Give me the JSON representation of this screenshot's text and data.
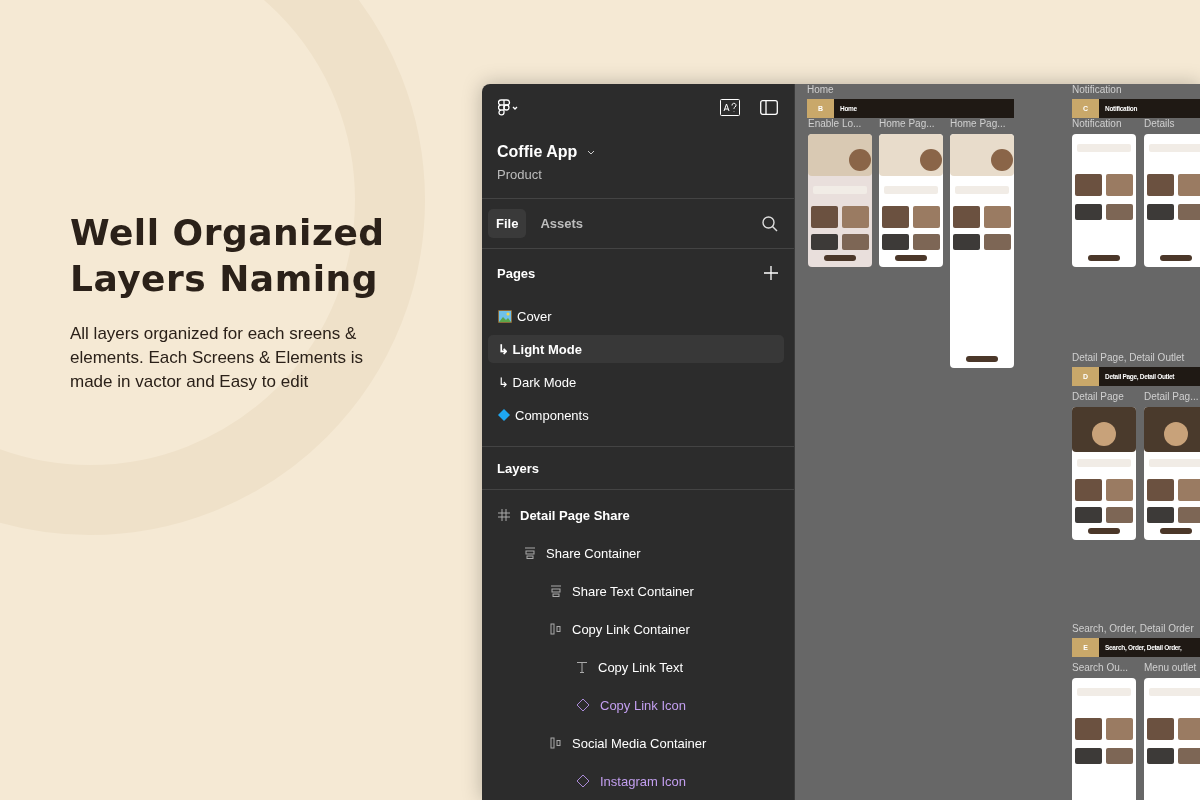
{
  "hero": {
    "title": "Well Organized Layers Naming",
    "text": "All layers organized for each sreens & elements. Each Screens & Elements is made in vactor and Easy to edit"
  },
  "sidebar": {
    "file_name": "Coffie App",
    "team": "Product",
    "tabs": [
      {
        "label": "File",
        "selected": true
      },
      {
        "label": "Assets",
        "selected": false
      }
    ],
    "pages_title": "Pages",
    "pages": [
      {
        "label": "Cover",
        "kind": "picture",
        "selected": false
      },
      {
        "label": "↳ Light Mode",
        "kind": "plain",
        "selected": true
      },
      {
        "label": "↳ Dark Mode",
        "kind": "plain",
        "selected": false
      },
      {
        "label": "Components",
        "kind": "component",
        "selected": false
      }
    ],
    "layers_title": "Layers",
    "layers": [
      {
        "name": "Detail Page Share",
        "kind": "frame",
        "children": [
          {
            "name": "Share Container",
            "kind": "vstack",
            "children": [
              {
                "name": "Share Text Container",
                "kind": "vstack"
              },
              {
                "name": "Copy Link Container",
                "kind": "hstack",
                "children": [
                  {
                    "name": "Copy Link Text",
                    "kind": "text"
                  },
                  {
                    "name": "Copy Link Icon",
                    "kind": "instance"
                  }
                ]
              },
              {
                "name": "Social Media Container",
                "kind": "hstack",
                "children": [
                  {
                    "name": "Instagram Icon",
                    "kind": "instance"
                  }
                ]
              }
            ]
          }
        ]
      }
    ]
  },
  "canvas": {
    "sections": [
      {
        "label": "Home",
        "badge": "B",
        "banner": "Home",
        "frames": [
          "Enable Lo...",
          "Home Pag...",
          "Home Pag..."
        ]
      },
      {
        "label": "Notification",
        "badge": "C",
        "banner": "Notification",
        "frames": [
          "Notification",
          "Details"
        ]
      },
      {
        "label": "Detail Page, Detail Outlet",
        "badge": "D",
        "banner": "Detail Page, Detail Outlet",
        "frames": [
          "Detail Page",
          "Detail Pag..."
        ]
      },
      {
        "label": "Search, Order, Detail Order",
        "badge": "E",
        "banner": "Search, Order, Detail Order,",
        "frames": [
          "Search Ou...",
          "Menu outlet"
        ]
      }
    ]
  }
}
